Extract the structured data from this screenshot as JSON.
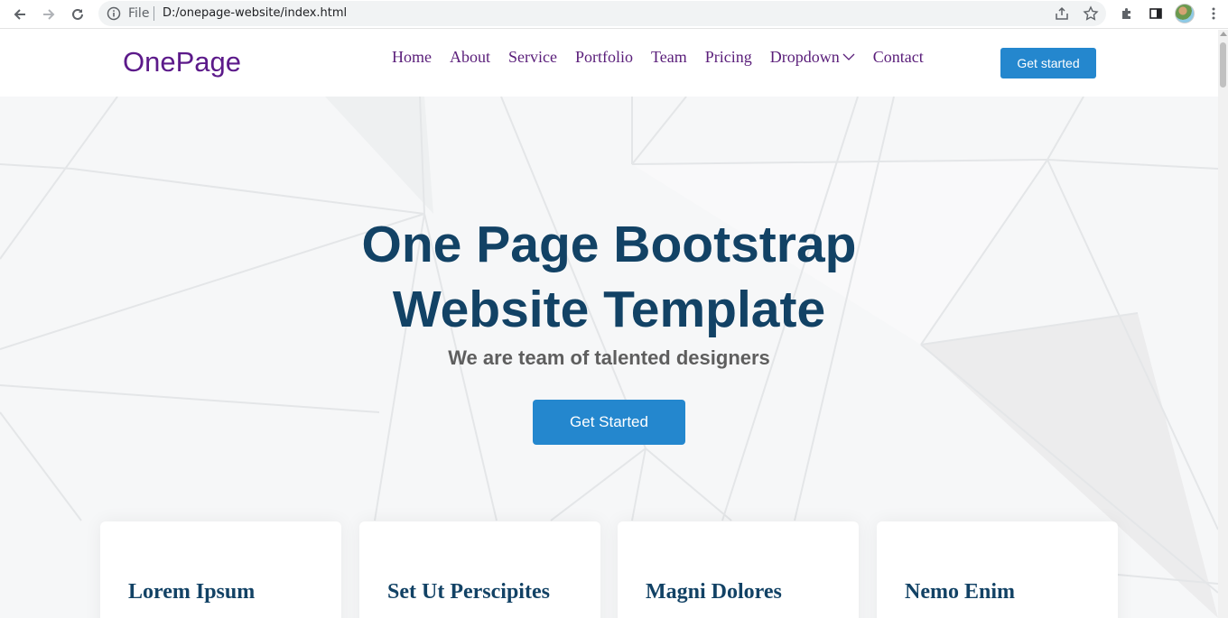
{
  "browser": {
    "scheme_label": "File",
    "url": "D:/onepage-website/index.html"
  },
  "header": {
    "logo": "OnePage",
    "nav": [
      {
        "label": "Home"
      },
      {
        "label": "About"
      },
      {
        "label": "Service"
      },
      {
        "label": "Portfolio"
      },
      {
        "label": "Team"
      },
      {
        "label": "Pricing"
      },
      {
        "label": "Dropdown",
        "icon": "chevron-down-icon"
      },
      {
        "label": "Contact"
      }
    ],
    "cta_label": "Get started"
  },
  "hero": {
    "title_line1": "One Page Bootstrap",
    "title_line2": "Website Template",
    "subtitle": "We are team of talented designers",
    "button_label": "Get Started"
  },
  "cards": [
    {
      "title": "Lorem Ipsum"
    },
    {
      "title": "Set Ut Perscipites"
    },
    {
      "title": "Magni Dolores"
    },
    {
      "title": "Nemo Enim"
    }
  ],
  "colors": {
    "brand": "#5c1a8a",
    "accent": "#2487ce",
    "heading": "#124265",
    "subtitle": "#5e5e5e"
  }
}
